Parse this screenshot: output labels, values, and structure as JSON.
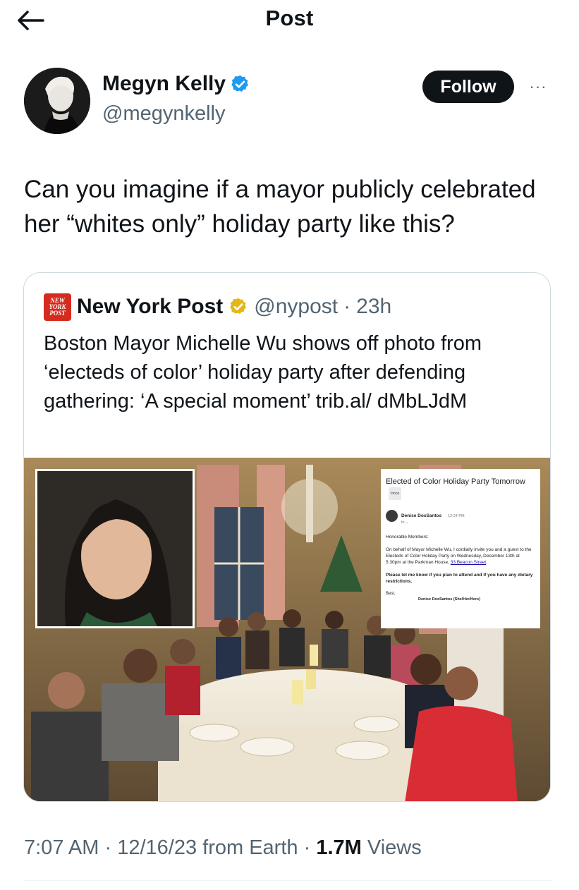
{
  "header": {
    "title": "Post",
    "back_icon": "arrow-left-icon"
  },
  "author": {
    "name": "Megyn Kelly",
    "handle": "@megynkelly",
    "verified_color": "#1d9bf0",
    "follow_label": "Follow",
    "more_label": "···"
  },
  "tweet": {
    "text": "Can you imagine if a mayor publicly celebrated her “whites only” holiday party like this?"
  },
  "quote": {
    "logo_lines": [
      "NEW",
      "YORK",
      "POST"
    ],
    "name": "New York Post",
    "badge_color": "#e2b719",
    "handle": "@nypost",
    "separator": "·",
    "time": "23h",
    "text": "Boston Mayor Michelle Wu shows off photo from ‘electeds of color’ holiday party after defending gathering: ‘A special moment’ trib.al/ dMbLJdM",
    "email": {
      "subject": "Elected of Color Holiday Party Tomorrow",
      "inbox_label": "Inbox",
      "from": "Denise DosSantos",
      "time": "12:24 PM",
      "to": "to ⌄",
      "greeting": "Honorable Members:",
      "body": "On behalf of Mayor Michelle Wu, I cordially invite you and a guest to the Electeds of Color Holiday Party on Wednesday, December 13th at 5:30pm at the Parkman House,",
      "link": "33 Beacon Street",
      "request": "Please let me know if you plan to attend and if you have any dietary restrictions.",
      "closing": "Best,",
      "signature": "Denise DosSantos (She/Her/Hers)"
    }
  },
  "meta": {
    "time": "7:07 AM",
    "sep1": "·",
    "date": "12/16/23 from Earth",
    "sep2": "·",
    "views_count": "1.7M",
    "views_label": "Views"
  }
}
